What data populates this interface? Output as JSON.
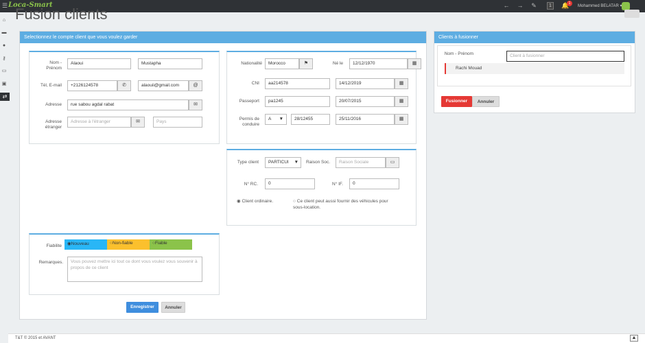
{
  "app": {
    "logo": "Loca-Smart",
    "user_name": "Mohammed BELATAR ▾",
    "notification_count": "1",
    "topbar_box": "1"
  },
  "page": {
    "title": "Fusion clients"
  },
  "left_panel": {
    "header": "Selectionnez le compte client que vous voulez garder",
    "identity": {
      "nom_prenom_label": "Nom - Prénom",
      "nom_value": "Alaoui",
      "prenom_value": "Mustapha",
      "tel_email_label": "Tél, E-mail",
      "tel_value": "+2126124578",
      "email_value": "alaouii@gmail.com",
      "adresse_label": "Adresse",
      "adresse_value": "rue sabou agdal rabat",
      "adresse_etranger_label": "Adresse étranger",
      "adresse_etranger_placeholder": "Adresse à l'étranger",
      "pays_placeholder": "Pays"
    },
    "documents": {
      "nationalite_label": "Nationalité",
      "nationalite_value": "Morocco",
      "ne_le_label": "Né le",
      "ne_le_value": "12/12/1970",
      "cni_label": "CNI",
      "cni_value": "aa214578",
      "cni_date": "14/12/2019",
      "passeport_label": "Passeport",
      "passeport_value": "pa1245",
      "passeport_date": "20/07/2015",
      "permis_label": "Permis de conduire",
      "permis_cat": "A",
      "permis_value": "28/12455",
      "permis_date": "25/11/2016"
    },
    "type": {
      "type_label": "Type client",
      "type_value": "PARTICUI",
      "raison_label": "Raison Soc.",
      "raison_placeholder": "Raison Sociale",
      "rc_label": "N° RC.",
      "rc_value": "0",
      "if_label": "N° IF.",
      "if_value": "0",
      "radio_ordinaire": "Client ordinaire.",
      "radio_fournisseur": "Ce client peut aussi fournir des véhicules pour sous-location."
    },
    "fiabilite": {
      "label": "Fiabilite",
      "opt_nouveau": "Nouveau",
      "opt_nonfiable": "Non-fiable",
      "opt_fiable": "Fiable",
      "remarques_label": "Remarques.",
      "remarques_placeholder": "Vous pouvez mettre ici tout ce dont vous voulez vous souvenir à propos de ce client"
    },
    "save_label": "Enregistrer",
    "cancel_label": "Annuler"
  },
  "right_panel": {
    "header": "Clients à fusionner",
    "nom_prenom_label": "Nom - Prénom",
    "search_placeholder": "Client à fusionner",
    "list": [
      "Rachi Mouad"
    ],
    "merge_label": "Fusionner",
    "cancel_label": "Annuler"
  },
  "footer": {
    "text": "T&T © 2015 et AVANT"
  },
  "colors": {
    "accent": "#5dade2",
    "nouveau": "#29b6f6",
    "nonfiable": "#fbc02d",
    "fiable": "#8bc34a",
    "danger": "#e53935",
    "primary": "#3f8ede"
  }
}
